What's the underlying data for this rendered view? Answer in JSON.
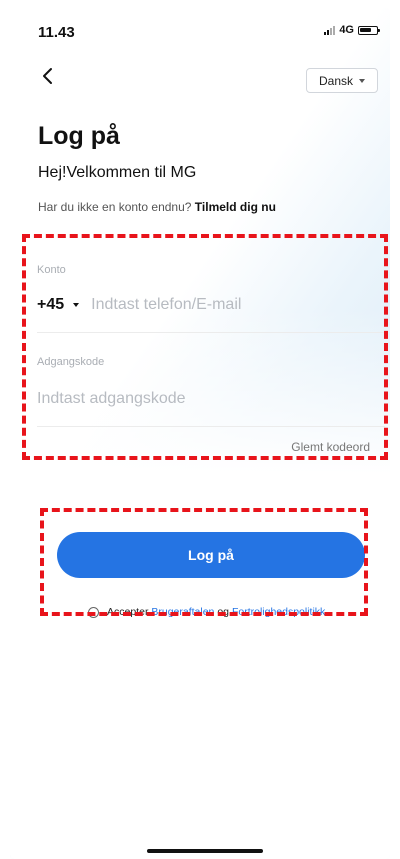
{
  "status_bar": {
    "time": "11.43",
    "network": "4G"
  },
  "header": {
    "language": "Dansk"
  },
  "page": {
    "title": "Log på",
    "welcome": "Hej!Velkommen til MG",
    "signup_prompt": "Har du ikke en konto endnu?",
    "signup_link": "Tilmeld dig nu"
  },
  "form": {
    "account_label": "Konto",
    "country_code": "+45",
    "account_placeholder": "Indtast telefon/E-mail",
    "password_label": "Adgangskode",
    "password_placeholder": "Indtast adgangskode",
    "forgot_password": "Glemt kodeord"
  },
  "actions": {
    "login_button": "Log på",
    "accept_prefix": "Accepter",
    "terms_link": "Brugeraftalen",
    "and": "og",
    "privacy_link": "Fortrolighedspolitikk"
  },
  "colors": {
    "accent": "#2574e3",
    "annotation": "#e8141b"
  }
}
